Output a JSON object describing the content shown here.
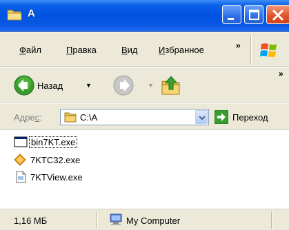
{
  "window": {
    "title": "A"
  },
  "menu": {
    "items": [
      {
        "underline": "Ф",
        "rest": "айл"
      },
      {
        "underline": "П",
        "rest": "равка"
      },
      {
        "underline": "В",
        "rest": "ид"
      },
      {
        "underline": "И",
        "rest": "збранное"
      }
    ],
    "overflow": "»"
  },
  "toolbar": {
    "back_label": "Назад",
    "overflow": "»"
  },
  "address": {
    "label_start": "Адре",
    "label_underline": "с",
    "label_end": ":",
    "value": "C:\\A",
    "go_label": "Переход"
  },
  "files": [
    {
      "name": "bin7KT.exe",
      "icon": "app-window-icon"
    },
    {
      "name": "7KTC32.exe",
      "icon": "diamond-app-icon"
    },
    {
      "name": "7KTView.exe",
      "icon": "viewer-app-icon"
    }
  ],
  "status": {
    "size": "1,16 МБ",
    "location": "My Computer"
  },
  "colors": {
    "titlebar": "#0052e0",
    "chrome": "#ece9d8"
  }
}
